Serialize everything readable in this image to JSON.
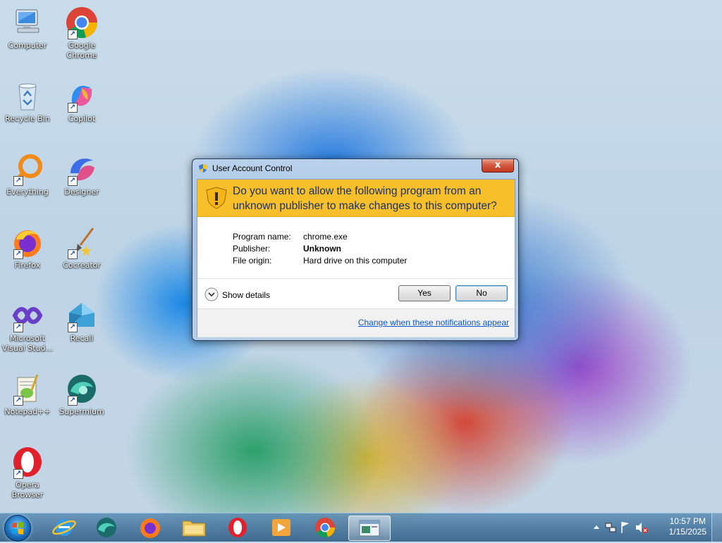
{
  "desktop_icons": [
    {
      "label": "Computer"
    },
    {
      "label": "Google Chrome"
    },
    {
      "label": "Recycle Bin"
    },
    {
      "label": "Copilot"
    },
    {
      "label": "Everything"
    },
    {
      "label": "Designer"
    },
    {
      "label": "Firefox"
    },
    {
      "label": "Cocreator"
    },
    {
      "label": "Microsoft Visual Stud..."
    },
    {
      "label": "Recall"
    },
    {
      "label": "Notepad++"
    },
    {
      "label": "Supermium"
    },
    {
      "label": "Opera Browser"
    }
  ],
  "uac": {
    "title": "User Account Control",
    "close_glyph": "x",
    "question": "Do you want to allow the following program from an unknown publisher to make changes to this computer?",
    "program_name_label": "Program name:",
    "program_name_value": "chrome.exe",
    "publisher_label": "Publisher:",
    "publisher_value": "Unknown",
    "file_origin_label": "File origin:",
    "file_origin_value": "Hard drive on this computer",
    "show_details": "Show details",
    "yes": "Yes",
    "no": "No",
    "change_link": "Change when these notifications appear"
  },
  "taskbar": {
    "pinned": [
      "internet-explorer-icon",
      "supermium-icon",
      "firefox-icon",
      "file-explorer-icon",
      "opera-icon",
      "media-player-icon",
      "chrome-icon",
      "uac-dialog-icon"
    ],
    "time": "10:57 PM",
    "date": "1/15/2025"
  },
  "colors": {
    "uac_banner": "#f7c02a",
    "link": "#0b58c9"
  }
}
